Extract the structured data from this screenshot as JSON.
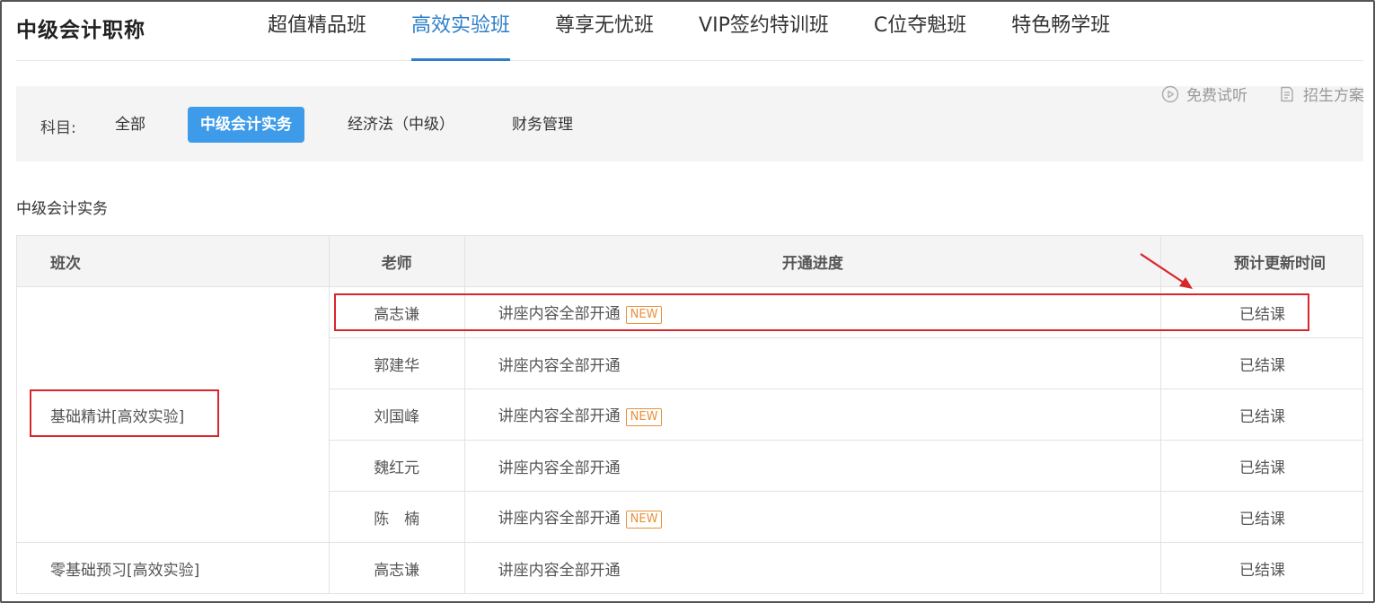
{
  "header": {
    "brand": "中级会计职称",
    "tabs": [
      "超值精品班",
      "高效实验班",
      "尊享无忧班",
      "VIP签约特训班",
      "C位夺魁班",
      "特色畅学班"
    ],
    "active_tab": 1
  },
  "tools": {
    "free_trial": "免费试听",
    "enrollment_plan": "招生方案"
  },
  "filter": {
    "label": "科目:",
    "subjects": [
      "全部",
      "中级会计实务",
      "经济法（中级）",
      "财务管理"
    ],
    "active_subject": 1
  },
  "section": {
    "title": "中级会计实务"
  },
  "table": {
    "headers": {
      "class": "班次",
      "teacher": "老师",
      "progress": "开通进度",
      "update_time": "预计更新时间"
    },
    "new_badge": "NEW",
    "groups": [
      {
        "class": "基础精讲[高效实验]",
        "rows": [
          {
            "teacher": "高志谦",
            "progress": "讲座内容全部开通",
            "is_new": true,
            "update_time": "已结课"
          },
          {
            "teacher": "郭建华",
            "progress": "讲座内容全部开通",
            "is_new": false,
            "update_time": "已结课"
          },
          {
            "teacher": "刘国峰",
            "progress": "讲座内容全部开通",
            "is_new": true,
            "update_time": "已结课"
          },
          {
            "teacher": "魏红元",
            "progress": "讲座内容全部开通",
            "is_new": false,
            "update_time": "已结课"
          },
          {
            "teacher": "陈　楠",
            "progress": "讲座内容全部开通",
            "is_new": true,
            "update_time": "已结课"
          }
        ]
      },
      {
        "class": "零基础预习[高效实验]",
        "rows": [
          {
            "teacher": "高志谦",
            "progress": "讲座内容全部开通",
            "is_new": false,
            "update_time": "已结课"
          }
        ]
      }
    ]
  },
  "colors": {
    "accent": "#2d7fc9",
    "chip_active": "#3d9be9",
    "badge": "#e8913a",
    "highlight": "#d9262b"
  }
}
